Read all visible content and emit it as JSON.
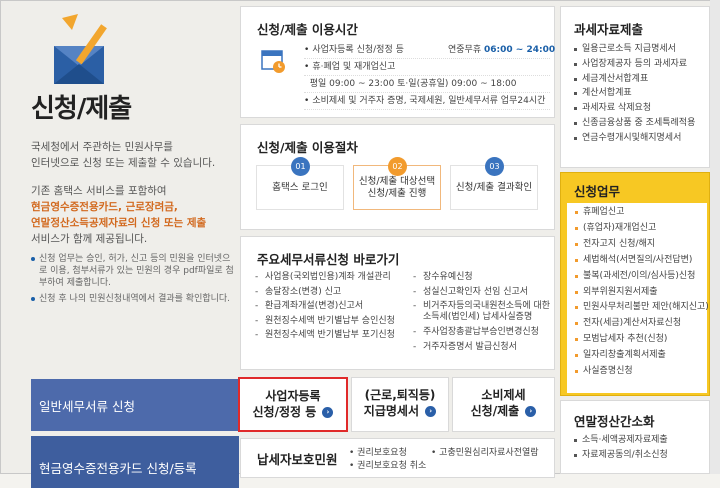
{
  "left": {
    "title": "신청/제출",
    "intro": [
      "국세청에서 주관하는 민원사무를",
      "인터넷으로 신청 또는 제출할 수 있습니다."
    ],
    "para_pre": "기존 홈택스 서비스를 포함하여",
    "para_hl1": "현금영수증전용카드, 근로장려금,",
    "para_hl2": "연말정산소득공제자료의 신청 또는 제출",
    "para_post": "서비스가 함께 제공됩니다.",
    "notes": [
      "신청 업무는 승인, 허가, 신고 등의 민원을 인터넷으로 이용, 첨부서류가 있는 민원의 경우 pdf파일로 첨부하여 제출합니다.",
      "신청 후 나의 민원신청내역에서 결과를 확인합니다."
    ],
    "nav": [
      "일반세무서류 신청",
      "현금영수증전용카드 신청/등록"
    ]
  },
  "time": {
    "title": "신청/제출 이용시간",
    "rows": [
      {
        "l": "사업자등록 신청/정정 등",
        "r1": "연중무휴 ",
        "r2": "06:00 ~ 24:00"
      },
      {
        "l": "휴·폐업 및 재개업신고",
        "r1": "",
        "r2": ""
      },
      {
        "l": "평일 09:00 ~ 23:00 토·일(공휴일) 09:00 ~ 18:00",
        "r1": "",
        "r2": ""
      },
      {
        "l": "소비제세 및 거주자 증명, 국제세원, 일반세무서류 업무24시간",
        "r1": "",
        "r2": ""
      }
    ]
  },
  "proc": {
    "title": "신청/제출 이용절차",
    "steps": [
      {
        "num": "01",
        "label": "홈택스 로그인"
      },
      {
        "num": "02",
        "label": "신청/제출 대상선택\n신청/제출 진행"
      },
      {
        "num": "03",
        "label": "신청/제출 결과확인"
      }
    ]
  },
  "docs": {
    "title": "주요세무서류신청 바로가기",
    "col1": [
      "사업용(국외법인용)계좌 개설관리",
      "송달장소(변경) 신고",
      "환급계좌개설(변경)신고서",
      "원천징수세액 반기별납부 승인신청",
      "원천징수세액 반기별납부 포기신청"
    ],
    "col2": [
      "장수유예신청",
      "성실신고확인자 선임 신고서",
      "비거주자등의국내원천소득에 대한 소득세(법인세) 납세사실증명",
      "주사업장총괄납부승인변경신청",
      "거주자증명서 발급신청서"
    ]
  },
  "bottom": [
    {
      "l1": "사업자등록",
      "l2": "신청/정정 등"
    },
    {
      "l1": "(근로,퇴직등)",
      "l2": "지급명세서"
    },
    {
      "l1": "소비제세",
      "l2": "신청/제출"
    }
  ],
  "protect": {
    "title": "납세자보호민원",
    "a": [
      "권리보호요청",
      "권리보호요청 취소"
    ],
    "b": [
      "고충민원심리자료사전열람"
    ]
  },
  "r1": {
    "title": "과세자료제출",
    "items": [
      "일용근로소득 지급명세서",
      "사업장제공자 등의 과세자료",
      "세금계산서합계표",
      "계산서합계표",
      "과세자료 삭제요청",
      "신종금융상품 중 조세특례적용",
      "연금수령개시및해지명세서"
    ]
  },
  "r2": {
    "title": "신청업무",
    "items": [
      "휴폐업신고",
      "(휴업자)재개업신고",
      "전자고지 신청/해지",
      "세법해석(서면질의/사전답변)",
      "불복(과세전/이의/심사등)신청",
      "외부위원지원서제출",
      "민원사무처리불만 제안(해지신고)",
      "전자(세금)계산서자료신청",
      "모범납세자 추천(신청)",
      "일자리창출계획서제출",
      "사실증명신청"
    ]
  },
  "r3": {
    "title": "연말정산간소화",
    "items": [
      "소득·세액공제자료제출",
      "자료제공동의/취소신청"
    ]
  },
  "colors": {
    "accent_blue": "#4a6fb0",
    "highlight": "#f7c823",
    "selected_border": "#e02a2a"
  }
}
